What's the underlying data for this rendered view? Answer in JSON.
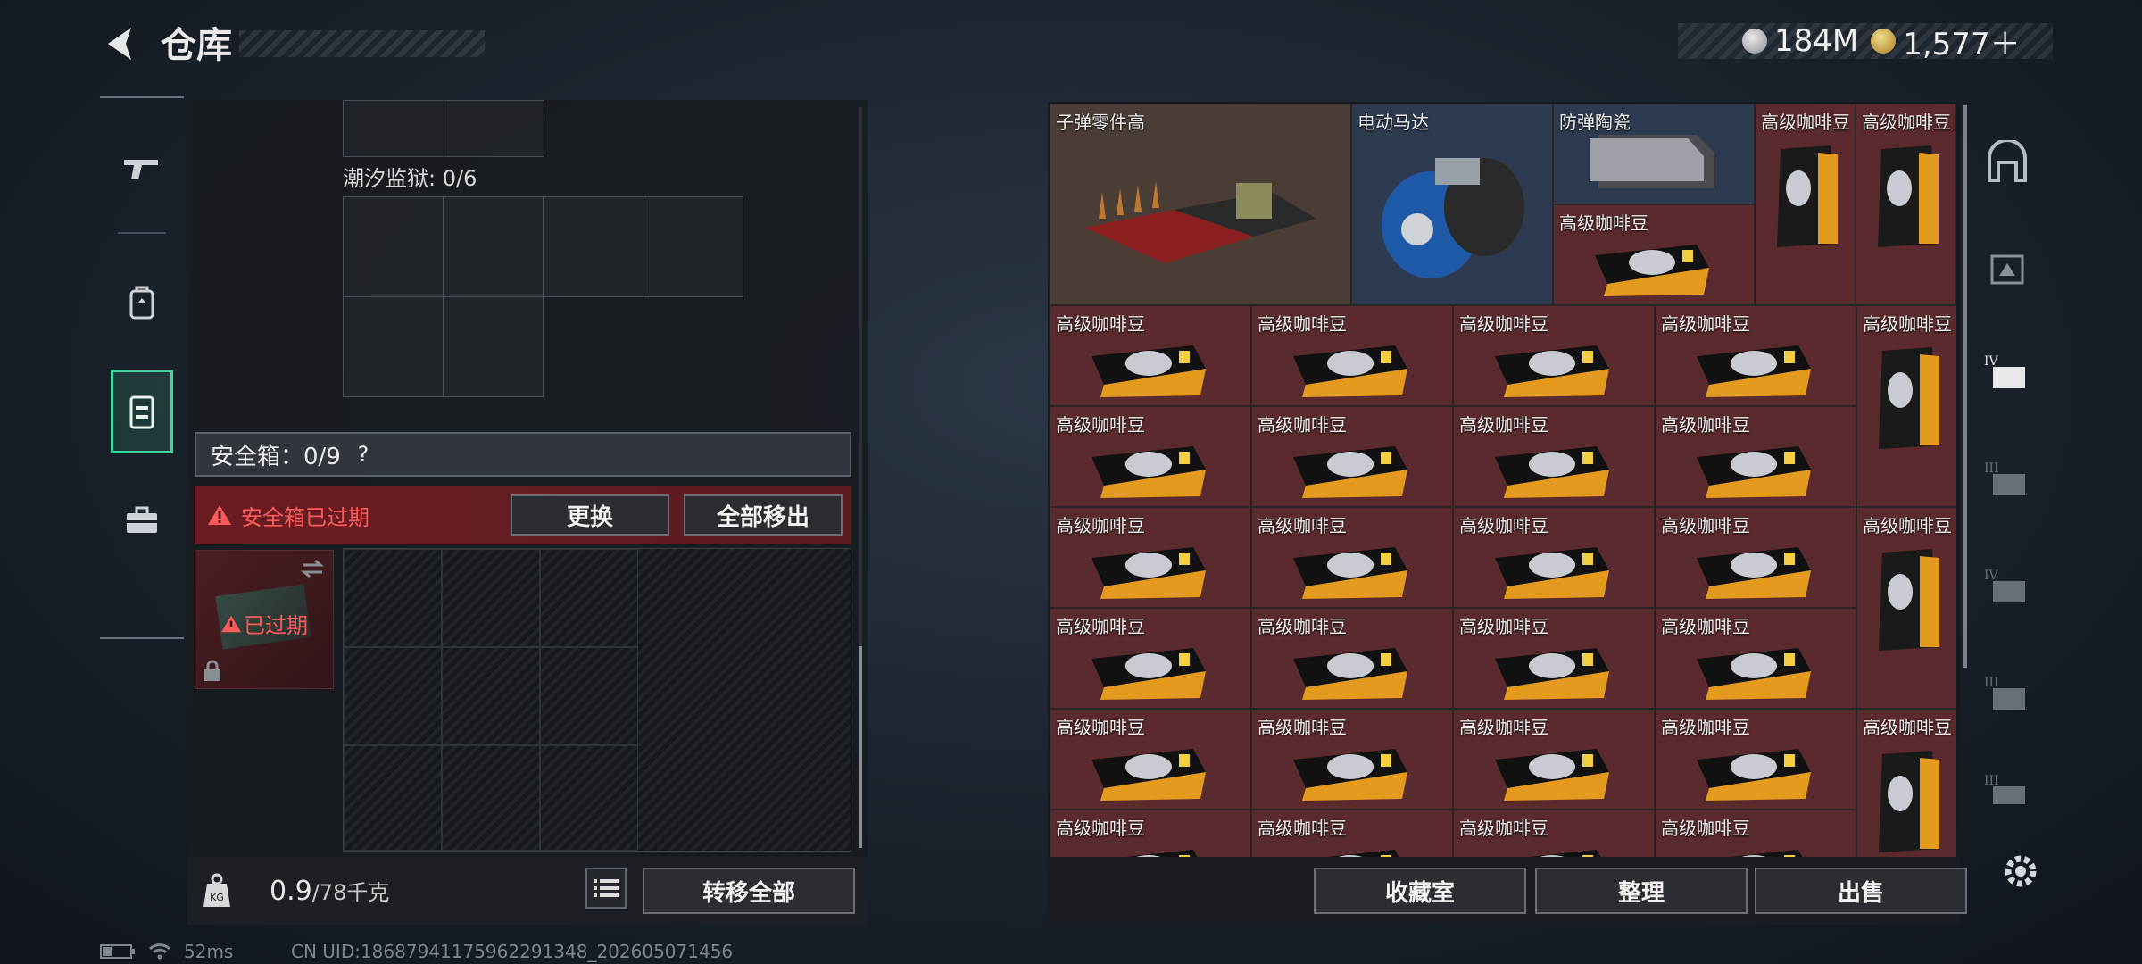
{
  "header": {
    "title": "仓库"
  },
  "currency": [
    {
      "icon": "silver-coin-icon",
      "value": "184M"
    },
    {
      "icon": "gold-coin-icon",
      "value": "1,577＋"
    }
  ],
  "left_rail": [
    "gun-icon",
    "backpack-icon",
    "vest-icon",
    "toolbox-icon"
  ],
  "left_panel": {
    "prison_label": "潮汐监狱: 0/6",
    "safe_box": {
      "label": "安全箱：0/9",
      "help": "?"
    },
    "expired_warning": "安全箱已过期",
    "replace_button": "更换",
    "move_all_button": "全部移出",
    "thumb_status": "已过期",
    "weight_value": "0.9",
    "weight_max": "/78千克",
    "transfer_all_button": "转移全部"
  },
  "items": {
    "bullet_parts": "子弹零件高",
    "motor": "电动马达",
    "ceramic": "防弹陶瓷",
    "coffee": "高级咖啡豆"
  },
  "right_bottom": {
    "collection_button": "收藏室",
    "sort_button": "整理",
    "sell_button": "出售"
  },
  "right_rail": [
    "home-icon",
    "tier-ii-icon",
    "tier-iv-icon",
    "tier-iii-icon",
    "tier-iv-icon",
    "tier-iii-icon",
    "tier-iii-icon"
  ],
  "status": {
    "ping": "52ms",
    "uid": "CN UID:18687941175962291348_202605071456"
  },
  "colors": {
    "accent": "#3fd6a0",
    "warning": "#ff5a5a",
    "item_bg": "#5a2a2e"
  }
}
